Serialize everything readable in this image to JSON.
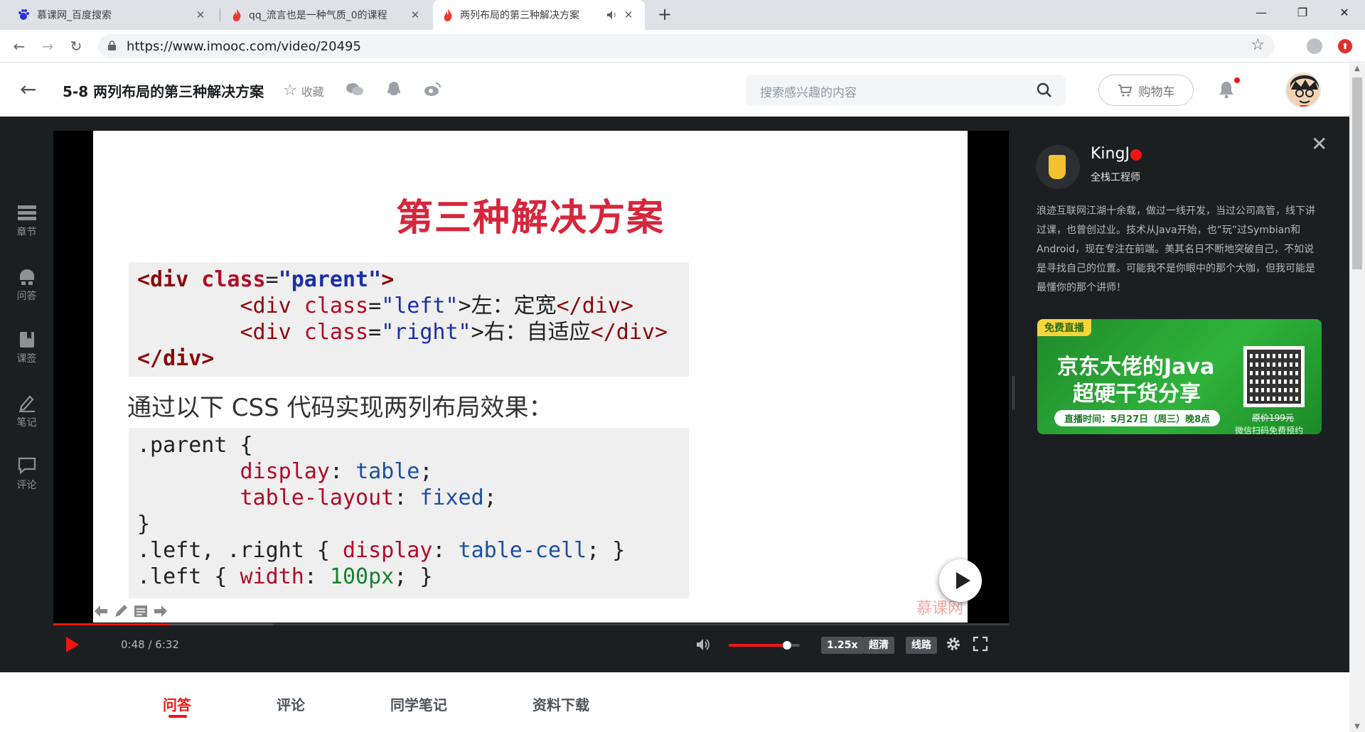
{
  "browser": {
    "tabs": [
      {
        "title": "慕课网_百度搜索",
        "icon": "baidu-icon"
      },
      {
        "title": "qq_流言也是一种气质_0的课程",
        "icon": "imooc-flame-icon"
      },
      {
        "title": "两列布局的第三种解决方案",
        "icon": "imooc-flame-icon",
        "active": true
      }
    ],
    "url": "https://www.imooc.com/video/20495"
  },
  "header": {
    "title": "5-8 两列布局的第三种解决方案",
    "favorite_label": "收藏",
    "search_placeholder": "搜索感兴趣的内容",
    "cart_label": "购物车"
  },
  "rail": [
    {
      "label": "章节",
      "icon": "chapter-icon"
    },
    {
      "label": "问答",
      "icon": "qa-icon"
    },
    {
      "label": "课签",
      "icon": "bookmark-icon"
    },
    {
      "label": "笔记",
      "icon": "note-pen-icon"
    },
    {
      "label": "评论",
      "icon": "comment-icon"
    }
  ],
  "slide": {
    "title": "第三种解决方案",
    "subtitle": "通过以下 CSS 代码实现两列布局效果：",
    "watermark": "慕课网",
    "html_code": {
      "l1_open": "<div",
      "l1_attr": " class",
      "l1_eq": "=",
      "l1_val": "\"parent\"",
      "l1_close": ">",
      "l2_open": "        <div",
      "l2_attr": " class",
      "l2_eq": "=",
      "l2_val": "\"left\"",
      "l2_text": ">左：定宽",
      "l2_end": "</div>",
      "l3_open": "        <div",
      "l3_attr": " class",
      "l3_eq": "=",
      "l3_val": "\"right\"",
      "l3_text": ">右：自适应",
      "l3_end": "</div>",
      "l4": "</div>"
    },
    "css_code": {
      "l1": ".parent {",
      "l2_prop": "        display",
      "l2_colon": ": ",
      "l2_val": "table",
      "l2_end": ";",
      "l3_prop": "        table-layout",
      "l3_colon": ": ",
      "l3_val": "fixed",
      "l3_end": ";",
      "l4": "}",
      "l5_sel": ".left, .right { ",
      "l5_prop": "display",
      "l5_colon": ": ",
      "l5_val": "table-cell",
      "l5_end": "; }",
      "l6_sel": ".left { ",
      "l6_prop": "width",
      "l6_colon": ": ",
      "l6_val": "100px",
      "l6_end": "; }"
    }
  },
  "player": {
    "time": "0:48 / 6:32",
    "progress": 0.122,
    "buffered": 0.23,
    "volume": 0.82,
    "speed": "1.25x",
    "quality": "超清",
    "line": "线路"
  },
  "teacher": {
    "name": "KingJ",
    "role": "全栈工程师",
    "bio": "浪迹互联网江湖十余载，做过一线开发，当过公司高管，线下讲过课，也曾创过业。技术从Java开始，也“玩”过Symbian和Android，现在专注在前端。美其名日不断地突破自己，不如说是寻找自己的位置。可能我不是你眼中的那个大咖，但我可能是最懂你的那个讲师！"
  },
  "ad": {
    "badge": "免费直播",
    "headline1": "京东大佬的Java",
    "headline2": "超硬干货分享",
    "time": "直播时间：5月27日（周三）晚8点",
    "original_price": "原价199元",
    "scan": "微信扫码免费预约"
  },
  "bottom_tabs": [
    {
      "label": "问答",
      "active": true
    },
    {
      "label": "评论"
    },
    {
      "label": "同学笔记"
    },
    {
      "label": "资料下载"
    }
  ],
  "colors": {
    "accent": "#f01414",
    "slide_title": "#d6263c",
    "dark_bg": "#1c1f21"
  }
}
